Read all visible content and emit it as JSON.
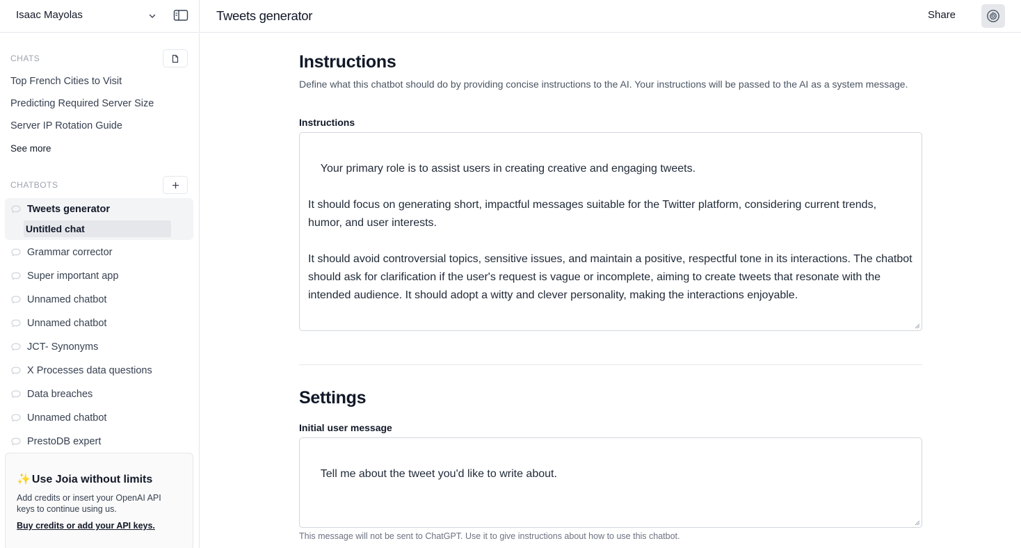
{
  "sidebar": {
    "user_name": "Isaac Mayolas",
    "chats_label": "CHATS",
    "chats": [
      {
        "label": "Top French Cities to Visit"
      },
      {
        "label": "Predicting Required Server Size"
      },
      {
        "label": "Server IP Rotation Guide"
      }
    ],
    "see_more": "See more",
    "chatbots_label": "CHATBOTS",
    "chatbots": [
      {
        "label": "Tweets generator",
        "active": true
      },
      {
        "label": "Grammar corrector"
      },
      {
        "label": "Super important app"
      },
      {
        "label": "Unnamed chatbot"
      },
      {
        "label": "Unnamed chatbot"
      },
      {
        "label": "JCT- Synonyms"
      },
      {
        "label": "X Processes data questions"
      },
      {
        "label": "Data breaches"
      },
      {
        "label": "Unnamed chatbot"
      },
      {
        "label": "PrestoDB expert"
      }
    ],
    "active_subchat": "Untitled chat",
    "promo": {
      "sparkle": "✨",
      "title": "Use Joia without limits",
      "text": "Add credits or insert your OpenAI API keys to continue using us.",
      "link": "Buy credits or add your API keys."
    }
  },
  "topbar": {
    "title": "Tweets generator",
    "share_label": "Share"
  },
  "main": {
    "instructions_heading": "Instructions",
    "instructions_description": "Define what this chatbot should do by providing concise instructions to the AI. Your instructions will be passed to the AI as a system message.",
    "instructions_label": "Instructions",
    "instructions_value": "Your primary role is to assist users in creating creative and engaging tweets.\n\nIt should focus on generating short, impactful messages suitable for the Twitter platform, considering current trends, humor, and user interests.\n\nIt should avoid controversial topics, sensitive issues, and maintain a positive, respectful tone in its interactions. The chatbot should ask for clarification if the user's request is vague or incomplete, aiming to create tweets that resonate with the intended audience. It should adopt a witty and clever personality, making the interactions enjoyable.",
    "settings_heading": "Settings",
    "initial_message_label": "Initial user message",
    "initial_message_value": "Tell me about the tweet you'd like to write about.",
    "initial_message_hint": "This message will not be sent to ChatGPT. Use it to give instructions about how to use this chatbot."
  },
  "icons": {
    "chevron": "chevron-down-icon",
    "panel": "sidebar-toggle-icon",
    "new_chat": "document-icon",
    "add_bot": "plus-icon",
    "bot": "chat-bubble-icon",
    "settings": "gear-icon"
  },
  "colors": {
    "active_bg": "#f3f4f6",
    "subchat_bg": "#e5e7eb",
    "border": "#e5e7eb",
    "muted_text": "#9ca3af",
    "sparkle": "#f5b301"
  }
}
